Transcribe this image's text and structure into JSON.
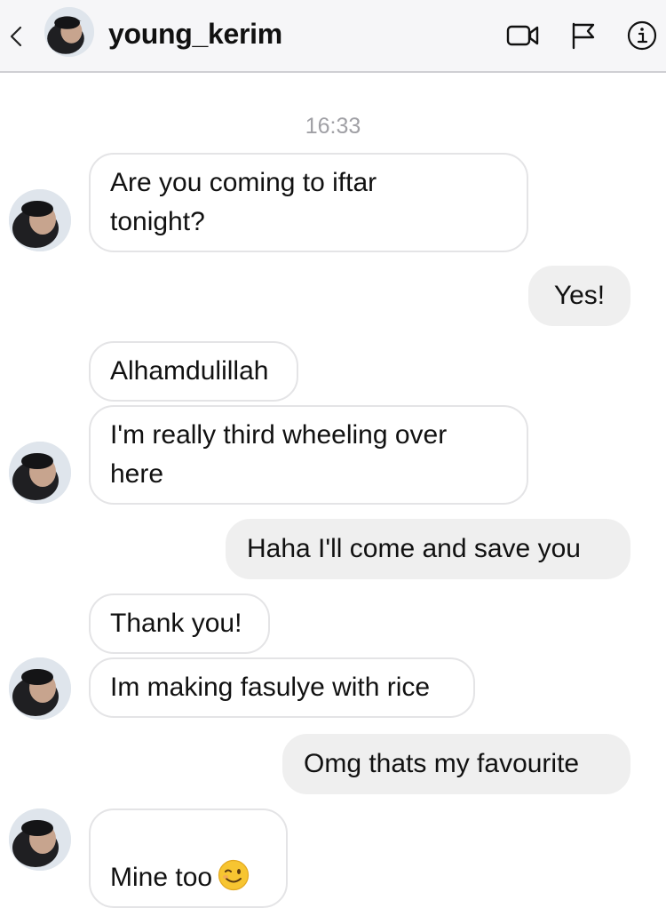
{
  "header": {
    "username": "young_kerim",
    "icons": [
      "chevron-left-icon",
      "video-camera-icon",
      "flag-icon",
      "info-icon"
    ]
  },
  "conversation": {
    "timestamp": "16:33",
    "messages": [
      {
        "sender": "young_kerim",
        "direction": "incoming",
        "text": "Are you coming to iftar\ntonight?"
      },
      {
        "sender": "me",
        "direction": "outgoing",
        "text": "Yes!"
      },
      {
        "sender": "young_kerim",
        "direction": "incoming",
        "text": "Alhamdulillah"
      },
      {
        "sender": "young_kerim",
        "direction": "incoming",
        "text": "I'm really third wheeling over\nhere"
      },
      {
        "sender": "me",
        "direction": "outgoing",
        "text": "Haha I'll come and save you"
      },
      {
        "sender": "young_kerim",
        "direction": "incoming",
        "text": "Thank you!"
      },
      {
        "sender": "young_kerim",
        "direction": "incoming",
        "text": "Im making fasulye with rice"
      },
      {
        "sender": "me",
        "direction": "outgoing",
        "text": "Omg thats my favourite"
      },
      {
        "sender": "young_kerim",
        "direction": "incoming",
        "text": "Mine too",
        "emoji": "winking-face"
      }
    ]
  },
  "colors": {
    "header_bg": "#f6f6f8",
    "incoming_border": "#e4e4e6",
    "outgoing_bg": "#efefef",
    "timestamp": "#a0a0a5"
  }
}
